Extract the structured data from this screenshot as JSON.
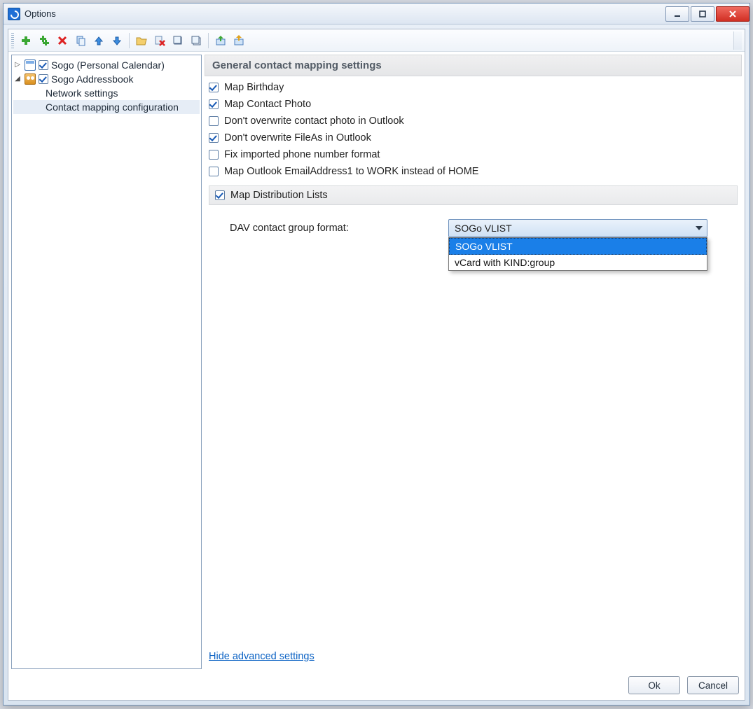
{
  "window": {
    "title": "Options"
  },
  "toolbar_icons": [
    "add-icon",
    "add-multi-icon",
    "delete-icon",
    "copy-icon",
    "move-up-icon",
    "move-down-icon",
    "open-folder-icon",
    "delete-cache-icon",
    "collapse-all-icon",
    "expand-all-icon",
    "import-icon",
    "export-icon"
  ],
  "tree": {
    "nodes": [
      {
        "label": "Sogo (Personal Calendar)",
        "expanded": false,
        "checked": true,
        "icon": "calendar-icon"
      },
      {
        "label": "Sogo Addressbook",
        "expanded": true,
        "checked": true,
        "icon": "addressbook-icon",
        "children": [
          {
            "label": "Network settings",
            "selected": false
          },
          {
            "label": "Contact mapping configuration",
            "selected": true
          }
        ]
      }
    ]
  },
  "panel": {
    "header": "General contact mapping settings",
    "options": [
      {
        "label": "Map Birthday",
        "checked": true
      },
      {
        "label": "Map Contact Photo",
        "checked": true
      },
      {
        "label": "Don't overwrite contact photo in Outlook",
        "checked": false
      },
      {
        "label": "Don't overwrite FileAs in Outlook",
        "checked": true
      },
      {
        "label": "Fix imported phone number format",
        "checked": false
      },
      {
        "label": "Map Outlook EmailAddress1 to WORK instead of HOME",
        "checked": false
      }
    ],
    "dist_lists": {
      "label": "Map Distribution Lists",
      "checked": true
    },
    "group_format": {
      "label": "DAV contact group format:",
      "selected": "SOGo VLIST",
      "options": [
        "SOGo VLIST",
        "vCard with KIND:group"
      ]
    },
    "advanced_link": "Hide advanced settings"
  },
  "buttons": {
    "ok": "Ok",
    "cancel": "Cancel"
  }
}
